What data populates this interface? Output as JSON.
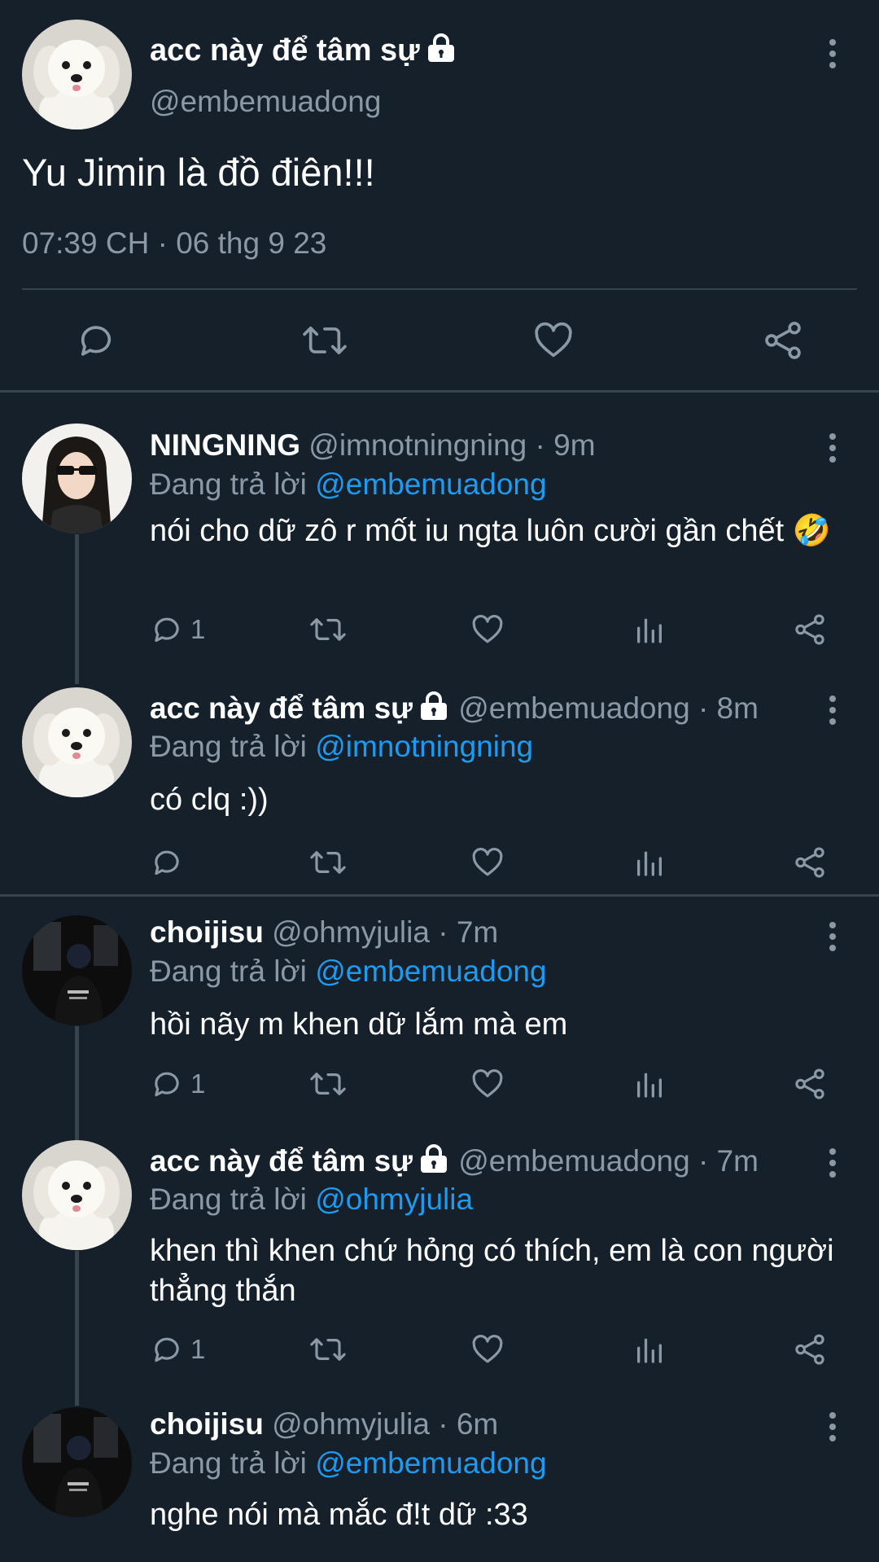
{
  "main_tweet": {
    "name": "acc này để tâm sự",
    "handle": "@embemuadong",
    "text": "Yu Jimin là đồ điên!!!",
    "timestamp": "07:39 CH · 06 thg 9 23",
    "avatar": "white-puppy",
    "actions": [
      "reply-icon",
      "retweet-icon",
      "like-icon",
      "share-icon"
    ]
  },
  "replies": [
    {
      "name": "NINGNING",
      "handle": "@imnotningning",
      "time": "9m",
      "replying_prefix": "Đang trả lời",
      "replying_to": "@embemuadong",
      "text": "nói cho dữ zô r mốt iu ngta luôn cười gần chết 🤣",
      "reply_count": "1",
      "avatar": "girl-sunglasses",
      "protected": false
    },
    {
      "name": "acc này để tâm sự",
      "handle": "@embemuadong",
      "time": "8m",
      "replying_prefix": "Đang trả lời",
      "replying_to": "@imnotningning",
      "text": "có clq :))",
      "reply_count": "",
      "avatar": "white-puppy",
      "protected": true
    },
    {
      "name": "choijisu",
      "handle": "@ohmyjulia",
      "time": "7m",
      "replying_prefix": "Đang trả lời",
      "replying_to": "@embemuadong",
      "text": "hồi nãy m khen dữ lắm mà em",
      "reply_count": "1",
      "avatar": "person-dark",
      "protected": false
    },
    {
      "name": "acc này để tâm sự",
      "handle": "@embemuadong",
      "time": "7m",
      "replying_prefix": "Đang trả lời",
      "replying_to": "@ohmyjulia",
      "text": "khen thì khen chứ hỏng có thích, em là con người thẳng thắn",
      "reply_count": "1",
      "avatar": "white-puppy",
      "protected": true
    },
    {
      "name": "choijisu",
      "handle": "@ohmyjulia",
      "time": "6m",
      "replying_prefix": "Đang trả lời",
      "replying_to": "@embemuadong",
      "text": "nghe nói mà mắc đ!t dữ :33",
      "reply_count": "",
      "avatar": "person-dark",
      "protected": false
    }
  ],
  "separator": "·",
  "colors": {
    "background": "#15202b",
    "divider": "#38444d",
    "secondary_text": "#8b98a5",
    "link": "#1d9bf0"
  }
}
